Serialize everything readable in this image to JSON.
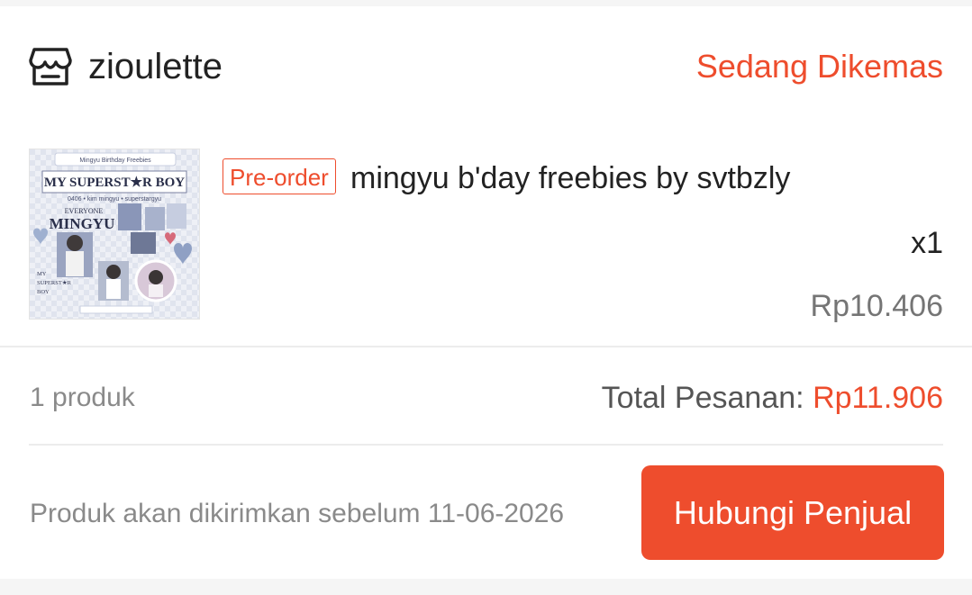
{
  "shop": {
    "icon": "store-icon",
    "name": "zioulette",
    "status": "Sedang Dikemas",
    "status_color": "#ee4d2d"
  },
  "product": {
    "badge": "Pre-order",
    "title": "mingyu b'day freebies by svtbzly",
    "quantity": "x1",
    "price": "Rp10.406",
    "image": {
      "banner": "MY SUPERST★R BOY",
      "top_caption": "Mingyu Birthday Freebies",
      "subcaption": "0406 • kim mingyu • superstargyu",
      "heading_small": "EVERYONE",
      "heading_big": "MINGYU",
      "side_text": [
        "MY",
        "SUPERST★R",
        "BOY"
      ]
    }
  },
  "summary": {
    "count": "1 produk",
    "total_label": "Total Pesanan: ",
    "total_amount": "Rp11.906"
  },
  "footer": {
    "note": "Produk akan dikirimkan sebelum 11-06-2026",
    "contact_button": "Hubungi Penjual"
  },
  "colors": {
    "accent": "#ee4d2d"
  }
}
